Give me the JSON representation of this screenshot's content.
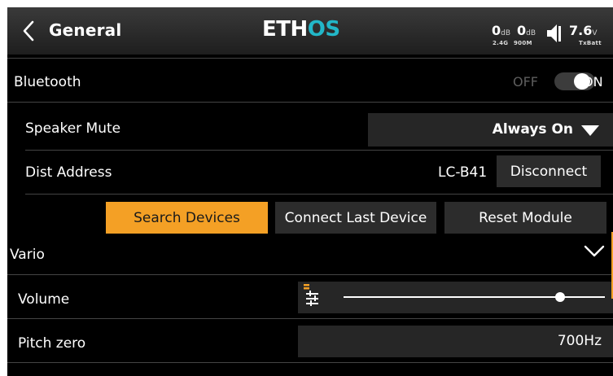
{
  "header": {
    "title": "General",
    "logo_part1": "ETH",
    "logo_part2": "OS",
    "logo_colors": {
      "primary": "#ffffff",
      "accent": "#22b7c8"
    },
    "rssi_24_value": "0",
    "rssi_24_unit": "dB",
    "rssi_24_sub": "2.4G",
    "rssi_900_value": "0",
    "rssi_900_unit": "dB",
    "rssi_900_sub": "900M",
    "volume_icon": "speaker-icon",
    "battery_value": "7.6",
    "battery_unit": "V",
    "battery_sub": "TxBatt"
  },
  "bluetooth": {
    "label": "Bluetooth",
    "toggle_off_label": "OFF",
    "toggle_on_label": "ON",
    "state": "ON"
  },
  "speaker_mute": {
    "label": "Speaker Mute",
    "value": "Always On"
  },
  "dist_address": {
    "label": "Dist Address",
    "value": "LC-B41",
    "disconnect_label": "Disconnect"
  },
  "actions": {
    "search_label": "Search Devices",
    "connect_last_label": "Connect Last Device",
    "reset_label": "Reset Module"
  },
  "vario": {
    "label": "Vario",
    "volume_label": "Volume",
    "volume_level": 0.83,
    "pitch_zero_label": "Pitch zero",
    "pitch_zero_value": "700Hz"
  },
  "colors": {
    "accent": "#f4a025",
    "background": "#000000",
    "field": "#262626"
  }
}
